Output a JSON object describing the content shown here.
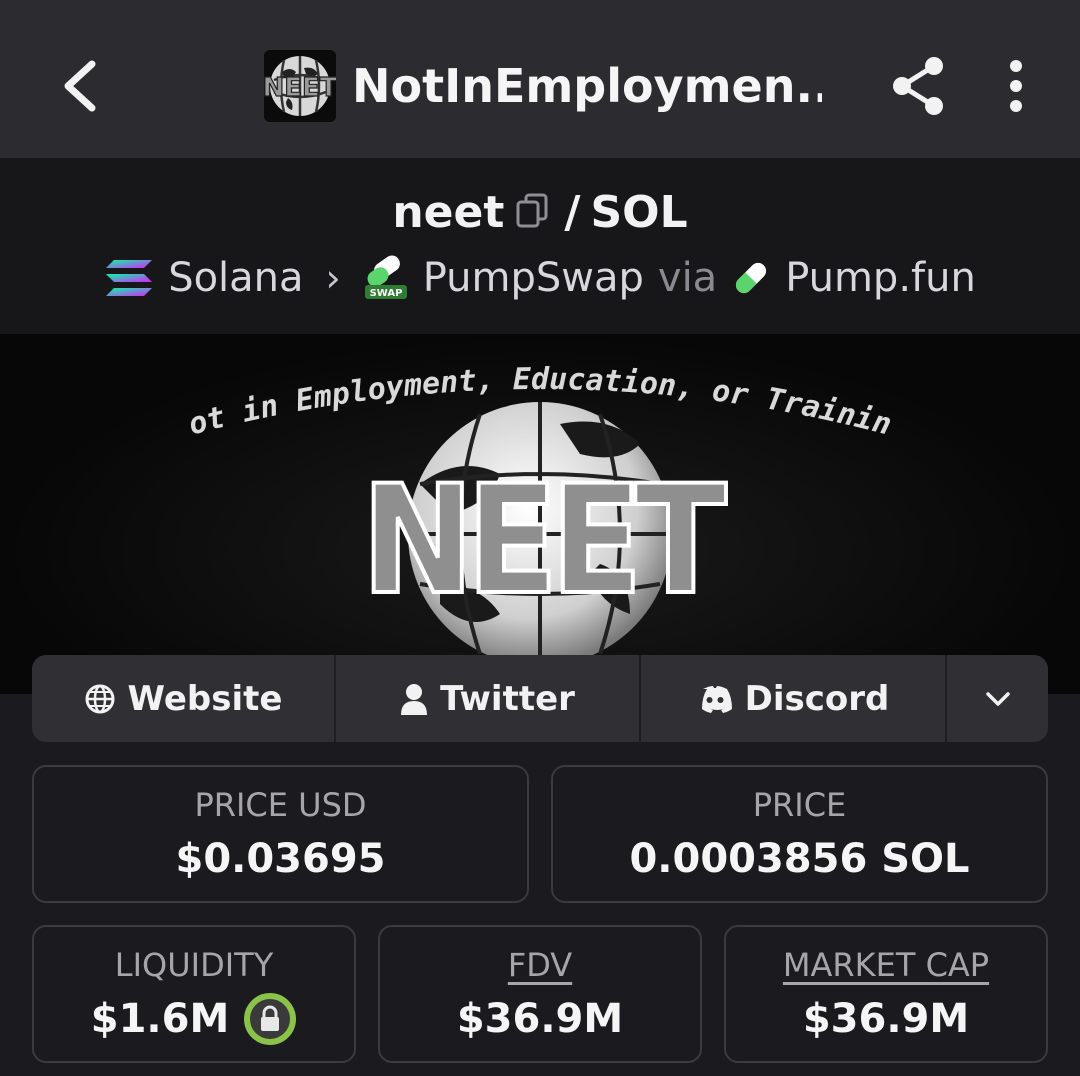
{
  "header": {
    "title": "NotInEmploymen...",
    "back_icon": "chevron-left-icon",
    "share_icon": "share-icon",
    "more_icon": "more-vertical-icon",
    "avatar_text": "NEET"
  },
  "pair": {
    "base": "neet",
    "separator": "/",
    "quote": "SOL"
  },
  "chain": {
    "network": "Solana",
    "dex": "PumpSwap",
    "via": "via",
    "launchpad": "Pump.fun",
    "dex_badge": "SWAP"
  },
  "banner": {
    "arc_text": "Not in Employment, Education, or Training",
    "logo_text": "NEET"
  },
  "links": {
    "website": "Website",
    "twitter": "Twitter",
    "discord": "Discord"
  },
  "stats": {
    "price_usd_label": "PRICE USD",
    "price_usd_value": "$0.03695",
    "price_label": "PRICE",
    "price_value": "0.0003856 SOL",
    "liquidity_label": "LIQUIDITY",
    "liquidity_value": "$1.6M",
    "fdv_label": "FDV",
    "fdv_value": "$36.9M",
    "mcap_label": "MARKET CAP",
    "mcap_value": "$36.9M"
  },
  "colors": {
    "background": "#1b1b1f",
    "topbar": "#2c2c30",
    "lock_ring": "#8bc34a"
  }
}
